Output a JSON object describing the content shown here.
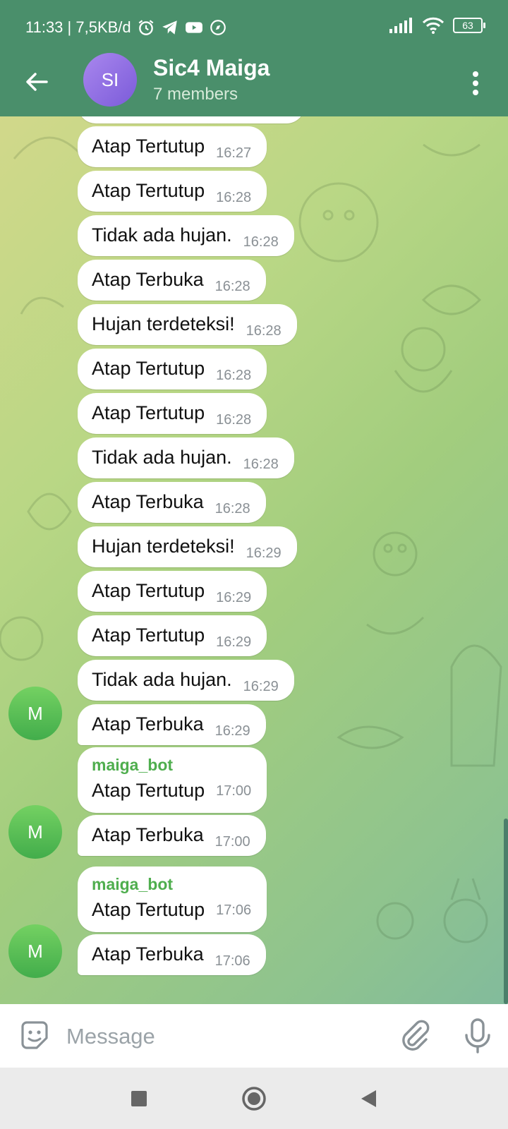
{
  "status_bar": {
    "time_speed": "11:33 | 7,5KB/d",
    "battery": "63",
    "icons": [
      "alarm-icon",
      "telegram-icon",
      "youtube-icon",
      "compass-icon",
      "signal-icon",
      "wifi-icon",
      "battery-icon"
    ]
  },
  "header": {
    "avatar_initials": "SI",
    "title": "Sic4 Maiga",
    "subtitle": "7 members",
    "accent": "#4a8f6b"
  },
  "messages": [
    {
      "text": "Atap Tertutup",
      "time": "16:27"
    },
    {
      "text": "Atap Tertutup",
      "time": "16:28"
    },
    {
      "text": "Tidak ada hujan.",
      "time": "16:28"
    },
    {
      "text": "Atap Terbuka",
      "time": "16:28"
    },
    {
      "text": "Hujan terdeteksi!",
      "time": "16:28"
    },
    {
      "text": "Atap Tertutup",
      "time": "16:28"
    },
    {
      "text": "Atap Tertutup",
      "time": "16:28"
    },
    {
      "text": "Tidak ada hujan.",
      "time": "16:28"
    },
    {
      "text": "Atap Terbuka",
      "time": "16:28"
    },
    {
      "text": "Hujan terdeteksi!",
      "time": "16:29"
    },
    {
      "text": "Atap Tertutup",
      "time": "16:29"
    },
    {
      "text": "Atap Tertutup",
      "time": "16:29"
    },
    {
      "text": "Tidak ada hujan.",
      "time": "16:29"
    },
    {
      "text": "Atap Terbuka",
      "time": "16:29",
      "avatar": "M"
    },
    {
      "sender": "maiga_bot",
      "text": "Atap Tertutup",
      "time": "17:00"
    },
    {
      "text": "Atap Terbuka",
      "time": "17:00",
      "avatar": "M"
    },
    {
      "sender": "maiga_bot",
      "text": "Atap Tertutup",
      "time": "17:06"
    },
    {
      "text": "Atap Terbuka",
      "time": "17:06",
      "avatar": "M"
    }
  ],
  "input": {
    "placeholder": "Message"
  },
  "colors": {
    "sender_name": "#4fae4e",
    "bubble": "#ffffff",
    "avatar_m": "#4fb454",
    "avatar_group": "#8e6de6"
  }
}
